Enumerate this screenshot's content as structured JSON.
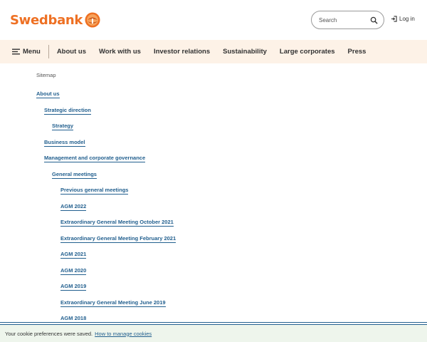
{
  "header": {
    "brand": "Swedbank",
    "search_placeholder": "Search",
    "login_label": "Log in"
  },
  "nav": {
    "menu_label": "Menu",
    "items": [
      "About us",
      "Work with us",
      "Investor relations",
      "Sustainability",
      "Large corporates",
      "Press"
    ]
  },
  "sitemap": {
    "title": "Sitemap",
    "links": [
      {
        "label": "About us",
        "level": 1
      },
      {
        "label": "Strategic direction",
        "level": 2
      },
      {
        "label": "Strategy",
        "level": 3
      },
      {
        "label": "Business model",
        "level": 2
      },
      {
        "label": "Management and corporate governance",
        "level": 2
      },
      {
        "label": "General meetings",
        "level": 3
      },
      {
        "label": "Previous general meetings",
        "level": 4
      },
      {
        "label": "AGM 2022",
        "level": 4
      },
      {
        "label": "Extraordinary General Meeting October 2021",
        "level": 4
      },
      {
        "label": "Extraordinary General Meeting February 2021",
        "level": 4
      },
      {
        "label": "AGM 2021",
        "level": 4
      },
      {
        "label": "AGM 2020",
        "level": 4
      },
      {
        "label": "AGM 2019",
        "level": 4
      },
      {
        "label": "Extraordinary General Meeting June 2019",
        "level": 4
      },
      {
        "label": "AGM 2018",
        "level": 4
      }
    ]
  },
  "cookie": {
    "message": "Your cookie preferences were saved.",
    "link": "How to manage cookies"
  },
  "colors": {
    "brand_orange": "#ee7023",
    "link_blue": "#23608f",
    "nav_bg": "#fdf2e7",
    "cookie_bg": "#eef5ec"
  }
}
